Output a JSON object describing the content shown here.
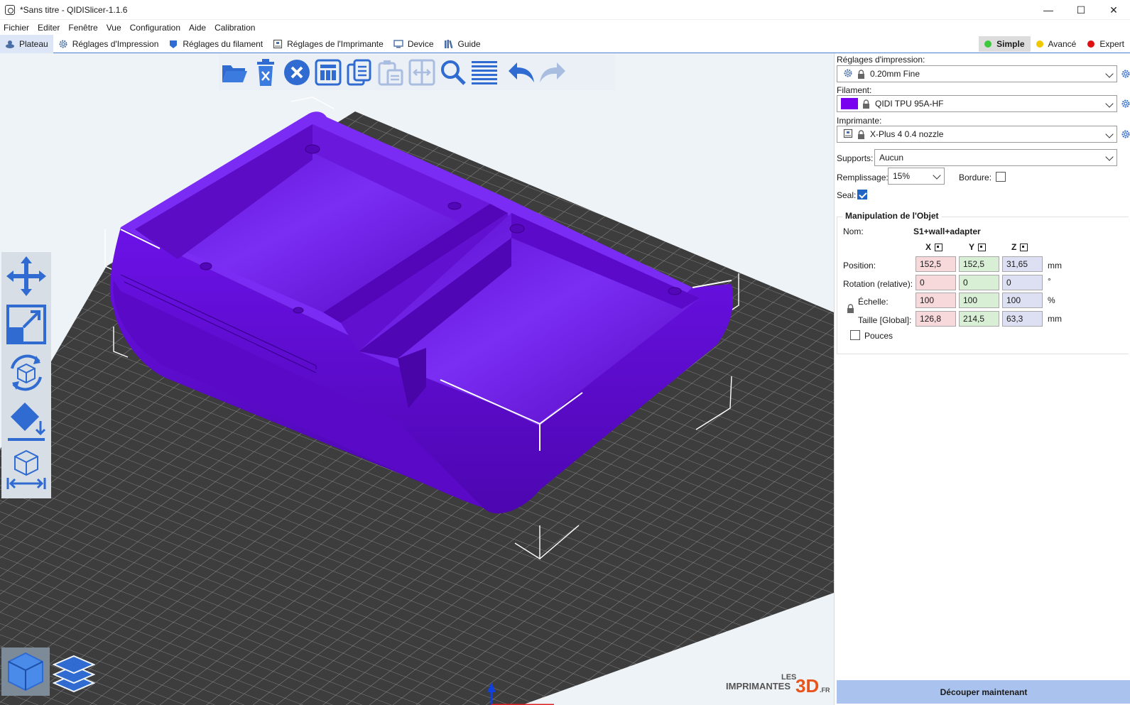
{
  "window": {
    "title": "*Sans titre - QIDISlicer-1.1.6",
    "minimize_glyph": "—",
    "maximize_glyph": "☐",
    "close_glyph": "✕"
  },
  "menu": [
    "Fichier",
    "Editer",
    "Fenêtre",
    "Vue",
    "Configuration",
    "Aide",
    "Calibration"
  ],
  "tabs": [
    {
      "label": "Plateau",
      "icon": "plate-icon",
      "active": true
    },
    {
      "label": "Réglages d'Impression",
      "icon": "gear-icon"
    },
    {
      "label": "Réglages du filament",
      "icon": "filament-spool-icon"
    },
    {
      "label": "Réglages de l'Imprimante",
      "icon": "printer-icon"
    },
    {
      "label": "Device",
      "icon": "device-icon"
    },
    {
      "label": "Guide",
      "icon": "books-icon"
    }
  ],
  "modes": [
    {
      "label": "Simple",
      "color": "#3dc93d",
      "active": true
    },
    {
      "label": "Avancé",
      "color": "#f0c800"
    },
    {
      "label": "Expert",
      "color": "#e01010"
    }
  ],
  "toolbar_top": [
    "open-folder-icon",
    "delete-icon",
    "delete-all-icon",
    "arrange-icon",
    "copy-icon",
    "paste-icon",
    "split-icon",
    "search-icon",
    "layers-list-icon",
    "undo-icon",
    "redo-icon"
  ],
  "toolbar_left": [
    "move-icon",
    "scale-icon",
    "rotate-icon",
    "place-on-face-icon",
    "measure-icon"
  ],
  "view_toggle": [
    "3d-view-icon",
    "preview-layers-icon"
  ],
  "watermark": {
    "les": "LES",
    "imprimantes": "IMPRIMANTES",
    "three_d": "3D",
    "fr": ".FR"
  },
  "panel": {
    "print_settings_label": "Réglages d'impression:",
    "print_settings_value": "0.20mm Fine",
    "filament_label": "Filament:",
    "filament_value": "QIDI TPU 95A-HF",
    "filament_color": "#7a00f0",
    "printer_label": "Imprimante:",
    "printer_value": "X-Plus 4 0.4 nozzle",
    "supports_label": "Supports:",
    "supports_value": "Aucun",
    "infill_label": "Remplissage:",
    "infill_value": "15%",
    "brim_label": "Bordure:",
    "brim_checked": false,
    "seal_label": "Seal:",
    "seal_checked": true
  },
  "object": {
    "group_title": "Manipulation de l'Objet",
    "name_label": "Nom:",
    "name_value": "S1+wall+adapter",
    "axes": [
      "X",
      "Y",
      "Z"
    ],
    "position_label": "Position:",
    "position": [
      "152,5",
      "152,5",
      "31,65"
    ],
    "position_unit": "mm",
    "rotation_label": "Rotation (relative):",
    "rotation": [
      "0",
      "0",
      "0"
    ],
    "rotation_unit": "°",
    "scale_label": "Échelle:",
    "scale": [
      "100",
      "100",
      "100"
    ],
    "scale_unit": "%",
    "size_label": "Taille [Global]:",
    "size": [
      "126,8",
      "214,5",
      "63,3"
    ],
    "size_unit": "mm",
    "inches_label": "Pouces",
    "inches_checked": false
  },
  "slice_button": "Découper maintenant",
  "colors": {
    "accent": "#3b7be0",
    "model": "#6a0fe0",
    "bed": "#3d3d3d",
    "slice_button": "#a9c3ee"
  }
}
